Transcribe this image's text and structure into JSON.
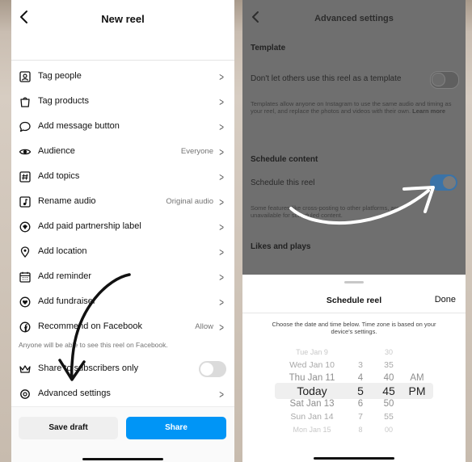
{
  "left": {
    "header": {
      "title": "New reel"
    },
    "menu": [
      {
        "label": "Tag people",
        "value": ""
      },
      {
        "label": "Tag products",
        "value": ""
      },
      {
        "label": "Add message button",
        "value": ""
      },
      {
        "label": "Audience",
        "value": "Everyone"
      },
      {
        "label": "Add topics",
        "value": ""
      },
      {
        "label": "Rename audio",
        "value": "Original audio"
      },
      {
        "label": "Add paid partnership label",
        "value": ""
      },
      {
        "label": "Add location",
        "value": ""
      },
      {
        "label": "Add reminder",
        "value": ""
      },
      {
        "label": "Add fundraiser",
        "value": ""
      },
      {
        "label": "Recommend on Facebook",
        "value": "Allow"
      }
    ],
    "facebook_note": "Anyone will be able to see this reel on Facebook.",
    "subscribers_label": "Share to subscribers only",
    "subscribers_on": false,
    "advanced_label": "Advanced settings",
    "footer": {
      "save_draft": "Save draft",
      "share": "Share"
    },
    "colors": {
      "share_button": "#0095f6",
      "draft_button": "#efefef"
    }
  },
  "right": {
    "header": {
      "title": "Advanced settings"
    },
    "template_heading": "Template",
    "template_toggle_label": "Don't let others use this reel as a template",
    "template_toggle_on": false,
    "template_desc": "Templates allow anyone on Instagram to use the same audio and timing as your reel, and replace the photos and videos with their own.",
    "learn_more": "Learn more",
    "schedule_heading": "Schedule content",
    "schedule_label": "Schedule this reel",
    "schedule_on": true,
    "schedule_desc_1": "Some features like cross-posting to other platforms, are",
    "schedule_desc_2": "unavailable for scheduled content.",
    "likes_heading": "Likes and plays",
    "sheet": {
      "title": "Schedule reel",
      "done": "Done",
      "note": "Choose the date and time below. Time zone is based on your device's settings.",
      "days": [
        "Tue Jan 9",
        "Wed Jan 10",
        "Thu Jan 11",
        "Today",
        "Sat Jan 13",
        "Sun Jan 14",
        "Mon Jan 15"
      ],
      "hours": [
        "3",
        "4",
        "5",
        "6",
        "7",
        "8"
      ],
      "minutes": [
        "30",
        "35",
        "40",
        "45",
        "50",
        "55",
        "00"
      ],
      "ampm": [
        "AM",
        "PM"
      ]
    },
    "colors": {
      "toggle_on": "#3a73a8"
    }
  }
}
